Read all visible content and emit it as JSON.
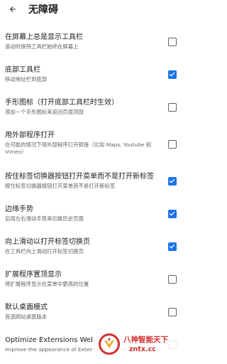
{
  "header": {
    "title": "无障碍",
    "back_icon": "arrow-left-icon"
  },
  "colors": {
    "accent": "#1a73e8",
    "title_text": "#202124",
    "sub_text": "#5f6368",
    "watermark": "#d32f2f"
  },
  "settings": [
    {
      "title": "在屏幕上总是显示工具栏",
      "subtitle": "滚动时保持工具栏始终在屏幕上",
      "checked": false
    },
    {
      "title": "底部工具栏",
      "subtitle": "移动地址栏到底部",
      "checked": true
    },
    {
      "title": "手形图标（打开底部工具栏时生效）",
      "subtitle": "添加一个手形图标来返回页面顶部",
      "checked": false
    },
    {
      "title": "用外部程序打开",
      "subtitle": "在可能的情况下用外部程序打开链接（比如 Maps, Youtube 和 Vimeo）",
      "checked": false
    },
    {
      "title": "按住标签切换器按钮打开菜单而不是打开新标签",
      "subtitle": "按住标签切换器按钮打开菜单而不是打开新标签",
      "checked": true
    },
    {
      "title": "边缘手势",
      "subtitle": "启用左右滑动手势来切换历史页面",
      "checked": true
    },
    {
      "title": "向上滑动以打开标签切换页",
      "subtitle": "在工具栏向上滑动打开标签切换页",
      "checked": true
    },
    {
      "title": "扩展程序置顶显示",
      "subtitle": "将扩展程序显示在菜单中更高的位置",
      "checked": false
    },
    {
      "title": "默认桌面模式",
      "subtitle": "首选网站桌面版本",
      "checked": false
    },
    {
      "title": "Optimize Extensions Web Store",
      "subtitle": "Improve the appearance of Extensions Web Store",
      "checked": false
    }
  ],
  "watermark": {
    "name": "八神智能天下",
    "url": "zntx.cc"
  }
}
